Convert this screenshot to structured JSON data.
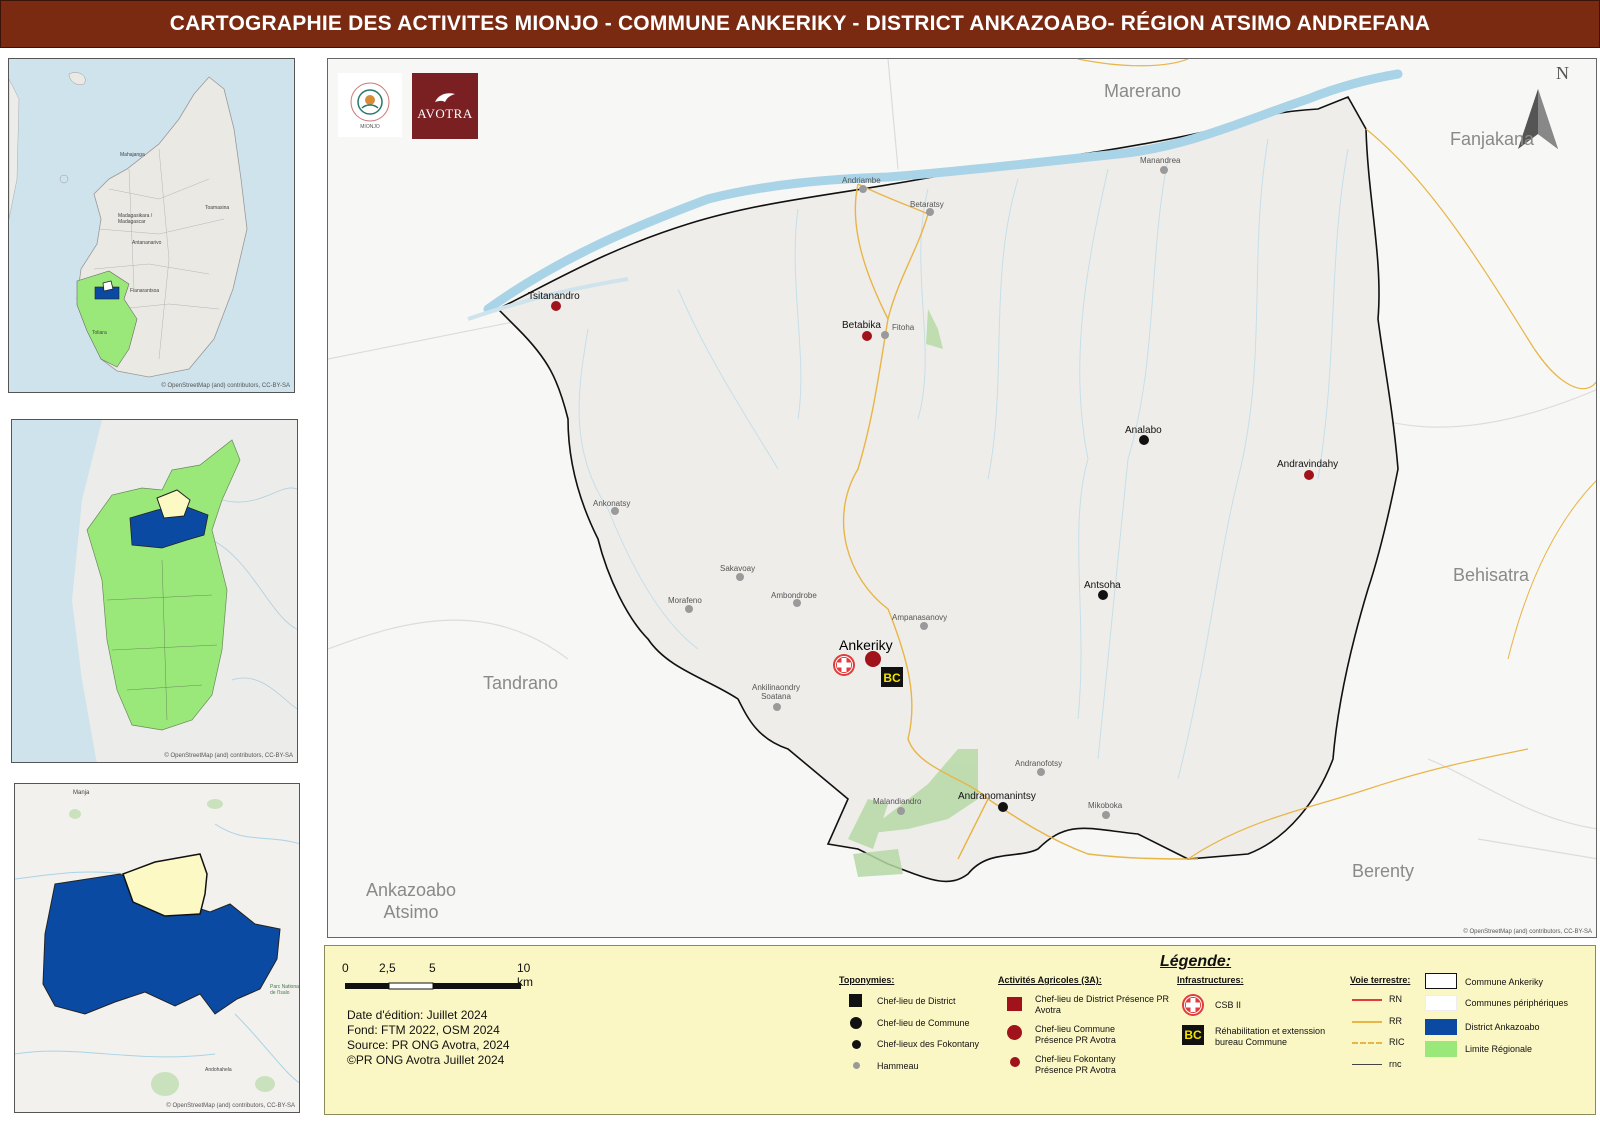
{
  "title": "CARTOGRAPHIE DES ACTIVITES MIONJO -  COMMUNE ANKERIKY - DISTRICT ANKAZOABO- RÉGION ATSIMO ANDREFANA",
  "insets": {
    "credit": "© OpenStreetMap (and) contributors, CC-BY-SA",
    "madagascar_labels": [
      "Mahajanga",
      "Toamasina",
      "Madagasikara / Madagascar",
      "Antananarivo",
      "Fianarantsoa",
      "Toliara"
    ],
    "district_park_label": "Parc National de l'Isalo",
    "district_labels": [
      "Manja",
      "Andohahela"
    ]
  },
  "logos": {
    "mionjo": "MIONJO",
    "avotra": "AVOTRA"
  },
  "north_label": "N",
  "map": {
    "neighbors": [
      "Marerano",
      "Fanjakana",
      "Behisatra",
      "Tandrano",
      "Berenty",
      "Ankazoabo Atsimo"
    ],
    "commune_capital": "Ankeriky",
    "fokontany_chefs": [
      "Tsitanandro",
      "Betabika",
      "Andravindahy"
    ],
    "commune_chefs": [
      "Analabo",
      "Antsoha",
      "Andranomanintsy"
    ],
    "hamlets": [
      "Andriambe",
      "Betaratsy",
      "Fitoha",
      "Manandrea",
      "Ankonatsy",
      "Sakavoay",
      "Ambondrobe",
      "Morafeno",
      "Ampanasanovy",
      "Ankilinaondry Soatana",
      "Andranofotsy",
      "Malandiandro",
      "Mikoboka"
    ],
    "credit": "© OpenStreetMap (and) contributors, CC-BY-SA"
  },
  "legend": {
    "title": "Légende:",
    "scale": {
      "ticks": [
        "0",
        "2,5",
        "5",
        "10 km"
      ]
    },
    "edition": [
      "Date d'édition: Juillet 2024",
      "Fond: FTM 2022, OSM 2024",
      "Source: PR ONG Avotra, 2024",
      "©PR ONG Avotra Juillet 2024"
    ],
    "toponymies": {
      "heading": "Toponymies:",
      "items": [
        "Chef-lieu de District",
        "Chef-lieu de Commune",
        "Chef-lieux des Fokontany",
        "Hammeau"
      ]
    },
    "activites": {
      "heading": "Activités Agricoles (3A):",
      "items": [
        "Chef-lieu de District Présence PR Avotra",
        "Chef-lieu Commune Présence PR Avotra",
        "Chef-lieu Fokontany Présence PR Avotra"
      ]
    },
    "infrastructures": {
      "heading": "Infrastructures:",
      "items": [
        "CSB II",
        "Réhabilitation et extenssion bureau Commune"
      ],
      "bc_symbol": "BC"
    },
    "voie": {
      "heading": "Voie terrestre:",
      "items": [
        "RN",
        "RR",
        "RIC",
        "rnc"
      ]
    },
    "areas": {
      "items": [
        "Commune Ankeriky",
        "Communes périphériques",
        "District Ankazoabo",
        "Limite Régionale"
      ]
    }
  },
  "colors": {
    "title_bg": "#7a2a10",
    "commune": "#f0efe9",
    "district": "#0b4aa3",
    "region": "#9be87a",
    "commune_inset": "#fdf9c4",
    "river": "#a9d3e6",
    "road_rr": "#e8b547",
    "csb_red": "#e23b3b",
    "dark_red": "#a1131a"
  }
}
